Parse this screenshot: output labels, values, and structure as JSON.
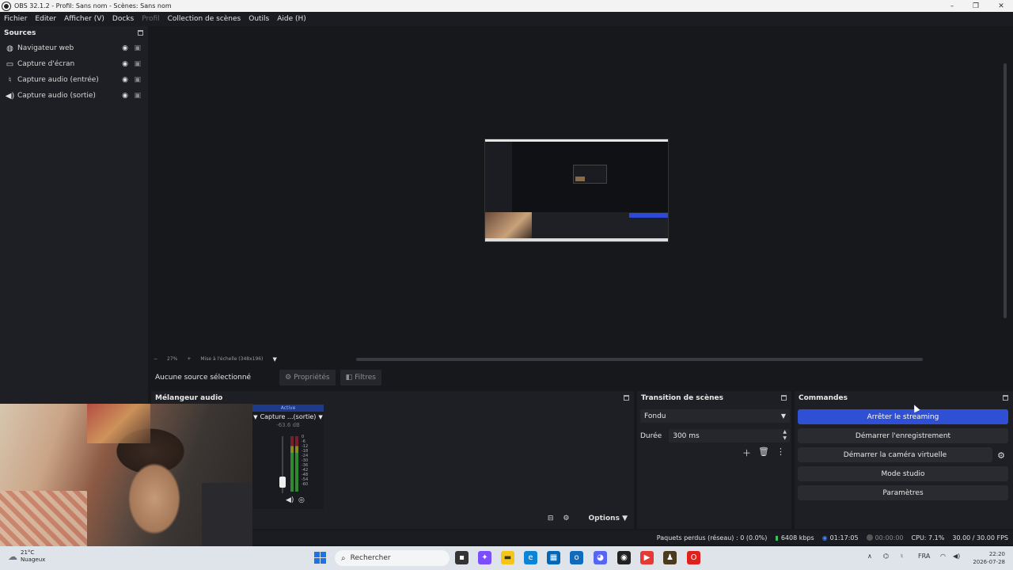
{
  "window": {
    "title": "OBS 32.1.2 - Profil: Sans nom - Scènes: Sans nom"
  },
  "menu": [
    "Fichier",
    "Editer",
    "Afficher (V)",
    "Docks",
    "Profil",
    "Collection de scènes",
    "Outils",
    "Aide (H)"
  ],
  "sources": {
    "title": "Sources",
    "items": [
      {
        "label": "Navigateur web",
        "icon": "globe-icon"
      },
      {
        "label": "Capture d'écran",
        "icon": "monitor-icon"
      },
      {
        "label": "Capture audio (entrée)",
        "icon": "microphone-icon"
      },
      {
        "label": "Capture audio (sortie)",
        "icon": "speaker-icon"
      }
    ]
  },
  "preview": {
    "zoom": "27%",
    "scale_label": "Mise à l'échelle (348x196)"
  },
  "source_toolbar": {
    "no_selection": "Aucune source sélectionné",
    "properties": "Propriétés",
    "filters": "Filtres"
  },
  "mixer": {
    "title": "Mélangeur audio",
    "active_label": "Active",
    "channel_name": "Capture ...(sortie)",
    "channel_db": "-63.6 dB",
    "scale": [
      "0",
      "-6",
      "-12",
      "-18",
      "-24",
      "-30",
      "-36",
      "-42",
      "-48",
      "-54",
      "-60"
    ],
    "options_label": "Options"
  },
  "transitions": {
    "title": "Transition de scènes",
    "selected": "Fondu",
    "duration_label": "Durée",
    "duration_value": "300 ms"
  },
  "commands": {
    "title": "Commandes",
    "buttons": [
      "Arrêter le streaming",
      "Démarrer l'enregistrement",
      "Démarrer la caméra virtuelle",
      "Mode studio",
      "Paramètres"
    ]
  },
  "status": {
    "dropped": "Paquets perdus (réseau) : 0 (0.0%)",
    "bitrate": "6408 kbps",
    "stream_time": "01:17:05",
    "rec_time": "00:00:00",
    "cpu": "CPU: 7.1%",
    "fps": "30.00 / 30.00 FPS"
  },
  "taskbar": {
    "temp": "21°C",
    "weather": "Nuageux",
    "search_placeholder": "Rechercher",
    "lang": "FRA",
    "time": "22:20",
    "date": "2026-07-28"
  },
  "colors": {
    "accent": "#2f4fd4",
    "bg": "#17181c",
    "dock": "#1e1f24"
  }
}
